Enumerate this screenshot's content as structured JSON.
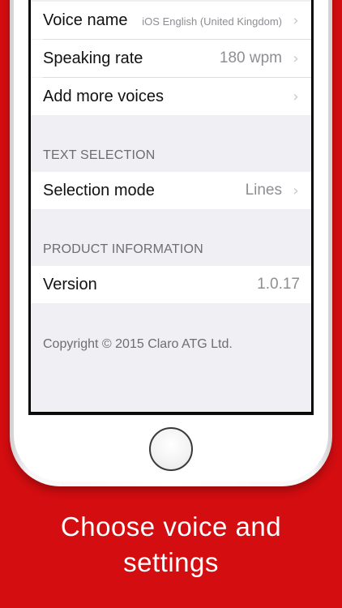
{
  "settings": {
    "voice_name_label": "Voice name",
    "voice_name_value": "iOS English (United Kingdom)",
    "speaking_rate_label": "Speaking rate",
    "speaking_rate_value": "180 wpm",
    "add_voices_label": "Add more voices",
    "text_selection_header": "TEXT SELECTION",
    "selection_mode_label": "Selection mode",
    "selection_mode_value": "Lines",
    "product_info_header": "PRODUCT INFORMATION",
    "version_label": "Version",
    "version_value": "1.0.17",
    "copyright": "Copyright © 2015 Claro ATG Ltd."
  },
  "icons": {
    "chevron": "chevron-right-icon"
  },
  "caption": {
    "line1": "Choose voice and",
    "line2": "settings"
  },
  "colors": {
    "background": "#d30d10",
    "grouped_background": "#efeff4",
    "secondary_text": "#8e8e93",
    "section_header": "#6d6d72"
  }
}
